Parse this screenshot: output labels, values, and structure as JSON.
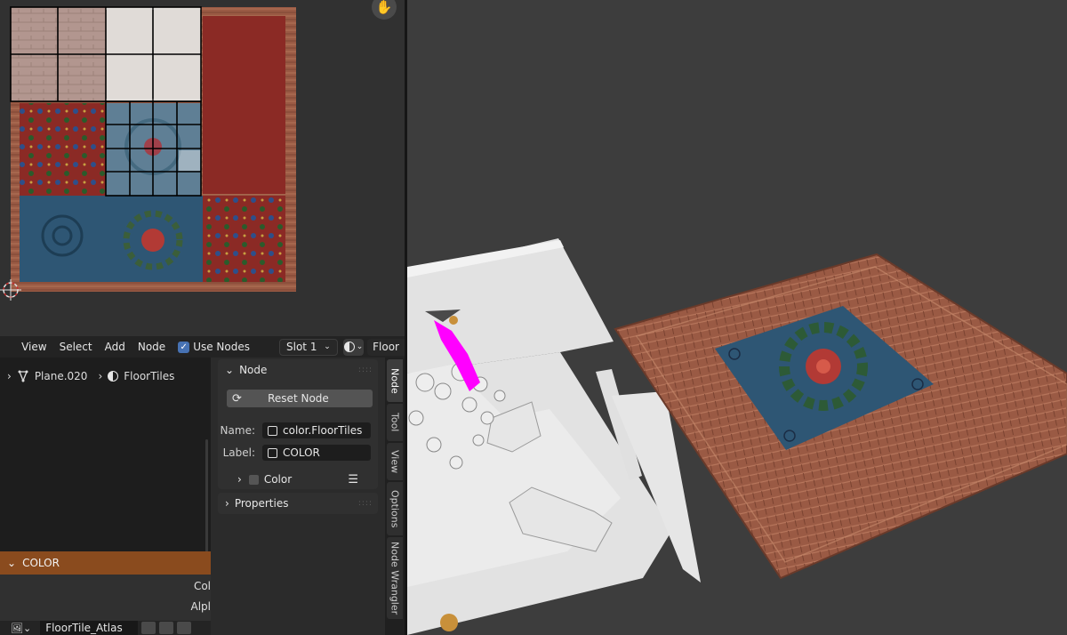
{
  "node_header": {
    "menus": [
      "View",
      "Select",
      "Add",
      "Node"
    ],
    "use_nodes_label": "Use Nodes",
    "use_nodes_checked": true,
    "slot_value": "Slot 1",
    "material_field": "Floor"
  },
  "breadcrumb": {
    "object": "Plane.020",
    "material": "FloorTiles"
  },
  "node_panel": {
    "section_title": "Node",
    "reset_button": "Reset Node",
    "name_label": "Name:",
    "name_value": "color.FloorTiles",
    "label_label": "Label:",
    "label_value": "COLOR",
    "color_sub": "Color",
    "properties_title": "Properties"
  },
  "sidebar_tabs": [
    "Node",
    "Tool",
    "View",
    "Options",
    "Node Wrangler"
  ],
  "color_node": {
    "title": "COLOR",
    "outputs": [
      "Col",
      "Alpl"
    ],
    "texture_name": "FloorTile_Atlas"
  },
  "colors": {
    "accent": "#4772b3",
    "node_header": "#8a4b1e",
    "selection_magenta": "#ff00ff",
    "tile_red": "#8b2a25",
    "tile_blue": "#2e5674",
    "wood": "#9a5a44"
  },
  "icons": {
    "object": "mesh-icon",
    "material": "material-icon",
    "reset": "refresh-icon",
    "pan": "hand-icon"
  }
}
